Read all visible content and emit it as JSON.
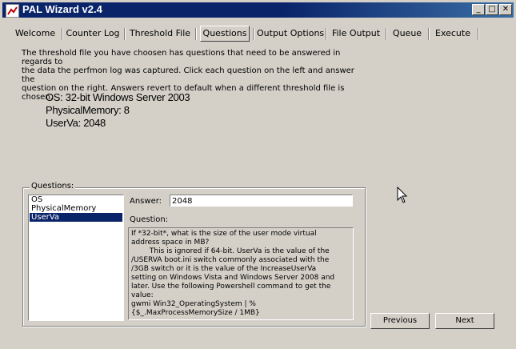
{
  "window": {
    "title": "PAL Wizard v2.4",
    "minimize": "_",
    "maximize": "□",
    "close": "✕"
  },
  "tabs": [
    {
      "label": "Welcome",
      "active": false
    },
    {
      "label": "Counter Log",
      "active": false
    },
    {
      "label": "Threshold File",
      "active": false
    },
    {
      "label": "Questions",
      "active": true
    },
    {
      "label": "Output Options",
      "active": false
    },
    {
      "label": "File Output",
      "active": false
    },
    {
      "label": "Queue",
      "active": false
    },
    {
      "label": "Execute",
      "active": false
    }
  ],
  "description": "The threshold file you have choosen has questions that need to be answered in regards to\nthe data the perfmon log was captured. Click each question on the left and answer the\nquestion on the right. Answers revert to default when a different threshold file is chosen.",
  "system_info": {
    "os": "OS: 32-bit Windows Server 2003",
    "memory": "PhysicalMemory: 8",
    "userva": "UserVa: 2048"
  },
  "questions_group": {
    "label": "Questions:",
    "items": [
      "OS",
      "PhysicalMemory",
      "UserVa"
    ],
    "selected": "UserVa",
    "answer_label": "Answer:",
    "answer_value": "2048",
    "question_label": "Question:",
    "question_text": "If *32-bit*, what is the size of the user mode virtual\naddress space in MB?\n        This is ignored if 64-bit. UserVa is the value of the\n/USERVA boot.ini switch commonly associated with the\n/3GB switch or it is the value of the IncreaseUserVa\nsetting on Windows Vista and Windows Server 2008 and\nlater. Use the following Powershell command to get the\nvalue:\ngwmi Win32_OperatingSystem | %\n{$_.MaxProcessMemorySize / 1MB}"
  },
  "buttons": {
    "previous": "Previous",
    "next": "Next"
  },
  "icons": {
    "app": "pal-app-icon",
    "cursor": "mouse-pointer-icon"
  },
  "colors": {
    "titlebar": "#0a246a",
    "window_bg": "#d4d0c8",
    "selection": "#0a246a"
  }
}
